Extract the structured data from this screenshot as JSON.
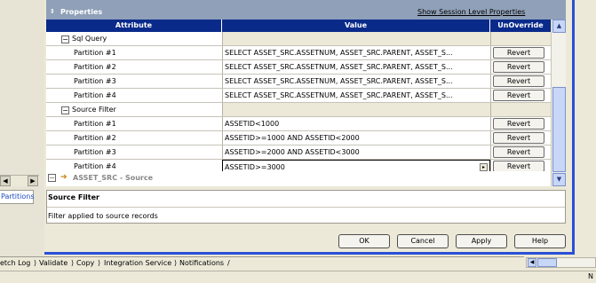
{
  "properties": {
    "title": "Properties",
    "show_link": "Show Session Level Properties"
  },
  "grid": {
    "columns": [
      "Attribute",
      "Value",
      "UnOverride"
    ],
    "sql_query_group": "Sql Query",
    "source_filter_group": "Source Filter",
    "sql_rows": [
      {
        "label": "Partition #1",
        "value": "SELECT ASSET_SRC.ASSETNUM, ASSET_SRC.PARENT, ASSET_S...",
        "btn": "Revert"
      },
      {
        "label": "Partition #2",
        "value": "SELECT ASSET_SRC.ASSETNUM, ASSET_SRC.PARENT, ASSET_S...",
        "btn": "Revert"
      },
      {
        "label": "Partition #3",
        "value": "SELECT ASSET_SRC.ASSETNUM, ASSET_SRC.PARENT, ASSET_S...",
        "btn": "Revert"
      },
      {
        "label": "Partition #4",
        "value": "SELECT ASSET_SRC.ASSETNUM, ASSET_SRC.PARENT, ASSET_S...",
        "btn": "Revert"
      }
    ],
    "filter_rows": [
      {
        "label": "Partition #1",
        "value": "ASSETID<1000",
        "btn": "Revert"
      },
      {
        "label": "Partition #2",
        "value": "ASSETID>=1000 AND ASSETID<2000",
        "btn": "Revert"
      },
      {
        "label": "Partition #3",
        "value": "ASSETID>=2000 AND ASSETID<3000",
        "btn": "Revert"
      },
      {
        "label": "Partition #4",
        "value": "ASSETID>=3000",
        "btn": "Revert"
      }
    ],
    "source_section": "ASSET_SRC - Source"
  },
  "description": {
    "title": "Source Filter",
    "text": "Filter applied to source records"
  },
  "buttons": {
    "ok": "OK",
    "cancel": "Cancel",
    "apply": "Apply",
    "help": "Help"
  },
  "left_tab": "Partitions",
  "bottom_tabs": [
    "etch Log",
    "Validate",
    "Copy",
    "Integration Service",
    "Notifications"
  ],
  "status_text": "N"
}
